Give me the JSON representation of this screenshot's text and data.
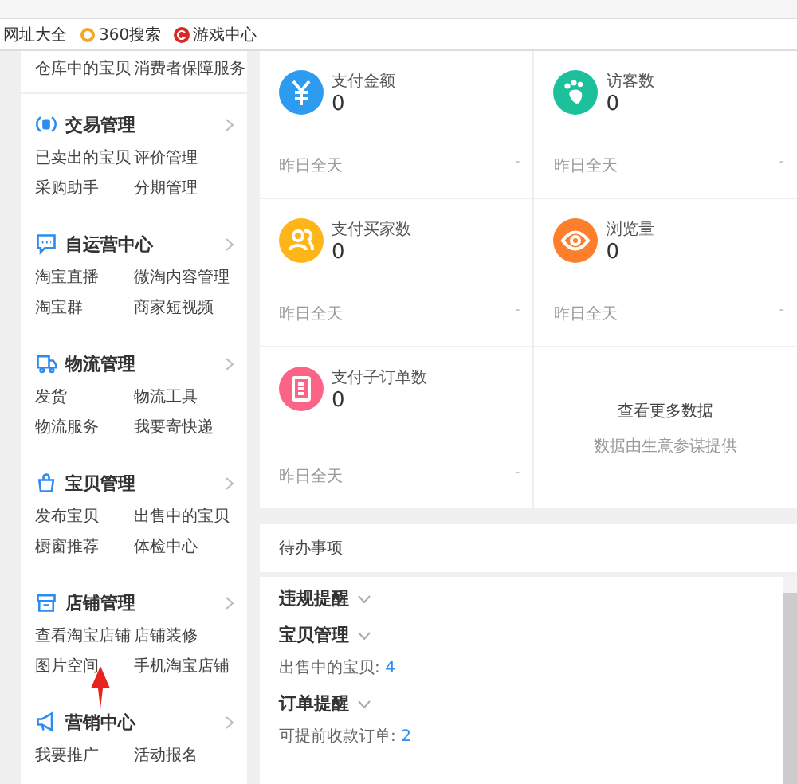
{
  "bookmarks": [
    "网址大全",
    "360搜索",
    "游戏中心"
  ],
  "sidebar": {
    "top_items": [
      "仓库中的宝贝",
      "消费者保障服务"
    ],
    "sections": [
      {
        "title": "交易管理",
        "items": [
          "已卖出的宝贝",
          "评价管理",
          "采购助手",
          "分期管理"
        ]
      },
      {
        "title": "自运营中心",
        "items": [
          "淘宝直播",
          "微淘内容管理",
          "淘宝群",
          "商家短视频"
        ]
      },
      {
        "title": "物流管理",
        "items": [
          "发货",
          "物流工具",
          "物流服务",
          "我要寄快递"
        ]
      },
      {
        "title": "宝贝管理",
        "items": [
          "发布宝贝",
          "出售中的宝贝",
          "橱窗推荐",
          "体检中心"
        ]
      },
      {
        "title": "店铺管理",
        "items": [
          "查看淘宝店铺",
          "店铺装修",
          "图片空间",
          "手机淘宝店铺"
        ]
      },
      {
        "title": "营销中心",
        "items": [
          "我要推广",
          "活动报名"
        ]
      }
    ]
  },
  "stats": [
    {
      "kind": "metric",
      "label": "支付金额",
      "value": "0",
      "period": "昨日全天",
      "change": "-",
      "color": "#2d9bf0"
    },
    {
      "kind": "metric",
      "label": "访客数",
      "value": "0",
      "period": "昨日全天",
      "change": "-",
      "color": "#1cc09a"
    },
    {
      "kind": "metric",
      "label": "支付买家数",
      "value": "0",
      "period": "昨日全天",
      "change": "-",
      "color": "#fdb51a"
    },
    {
      "kind": "metric",
      "label": "浏览量",
      "value": "0",
      "period": "昨日全天",
      "change": "-",
      "color": "#fd7f2c"
    },
    {
      "kind": "metric",
      "label": "支付子订单数",
      "value": "0",
      "period": "昨日全天",
      "change": "-",
      "color": "#fc6487"
    },
    {
      "kind": "more",
      "title": "查看更多数据",
      "subtitle": "数据由生意参谋提供"
    }
  ],
  "todo": {
    "title": "待办事项",
    "groups": [
      {
        "title": "违规提醒",
        "expanded": false
      },
      {
        "title": "宝贝管理",
        "expanded": false,
        "lines": [
          {
            "label": "出售中的宝贝:",
            "count": "4"
          }
        ]
      },
      {
        "title": "订单提醒",
        "expanded": false,
        "lines": [
          {
            "label": "可提前收款订单:",
            "count": "2"
          }
        ]
      }
    ]
  }
}
